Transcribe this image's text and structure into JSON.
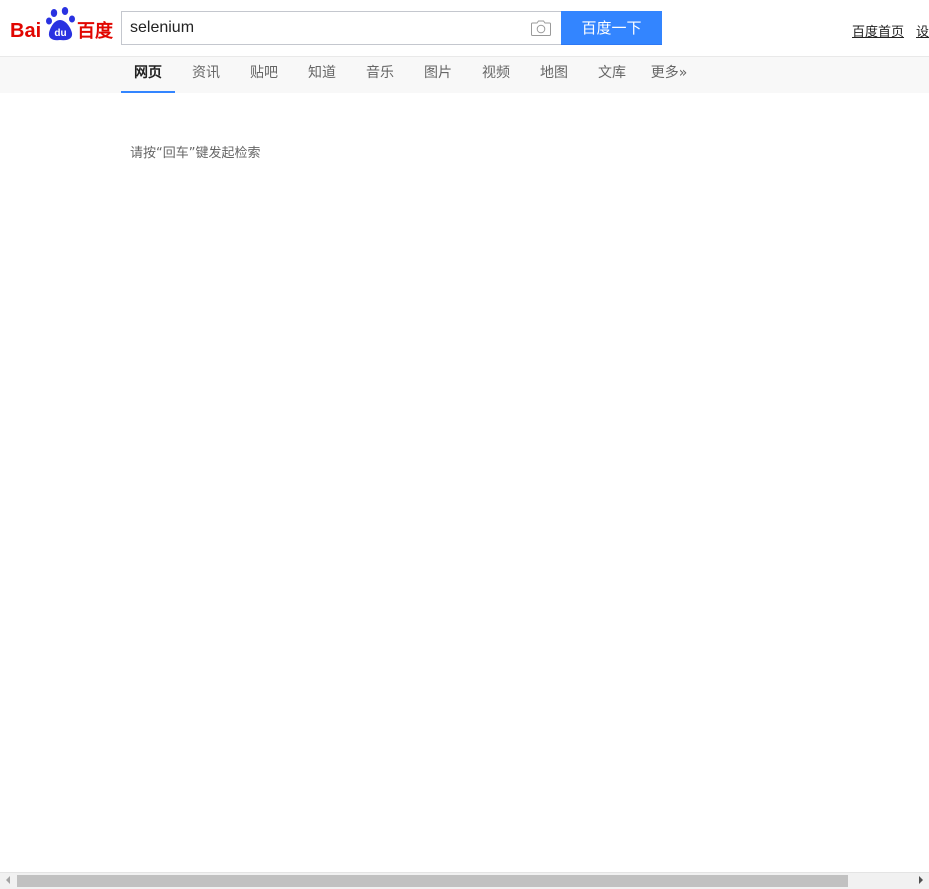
{
  "logo": {
    "text_left": "Bai",
    "text_badge": "du",
    "text_cn": "百度",
    "color": "#e10601",
    "paw_color": "#2932e1"
  },
  "search": {
    "value": "selenium",
    "placeholder": "",
    "button_label": "百度一下",
    "button_color": "#3385ff"
  },
  "top_links": [
    {
      "label": "百度首页"
    },
    {
      "label": "设置"
    }
  ],
  "tabs": [
    {
      "label": "网页",
      "active": true
    },
    {
      "label": "资讯"
    },
    {
      "label": "贴吧"
    },
    {
      "label": "知道"
    },
    {
      "label": "音乐"
    },
    {
      "label": "图片"
    },
    {
      "label": "视频"
    },
    {
      "label": "地图"
    },
    {
      "label": "文库"
    },
    {
      "label": "更多»"
    }
  ],
  "hint": "请按“回车”键发起检索",
  "icons": {
    "camera": "camera-icon",
    "paw": "paw-icon"
  }
}
